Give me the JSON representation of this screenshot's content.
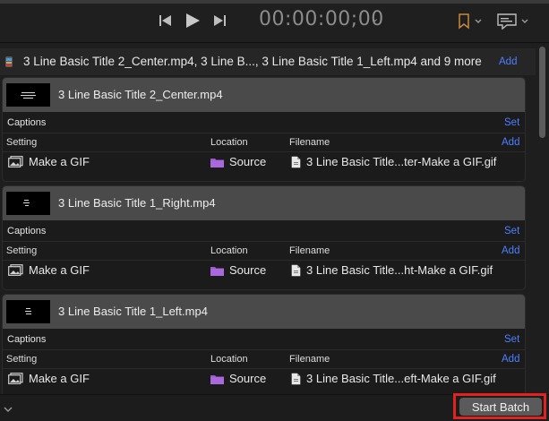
{
  "transport": {
    "timecode": "00:00:00;00",
    "timecode_caret": "⌄"
  },
  "batch": {
    "title": "3 Line Basic Title 2_Center.mp4, 3 Line B..., 3 Line Basic Title 1_Left.mp4 and 9 more",
    "add_label": "Add"
  },
  "labels": {
    "captions": "Captions",
    "set": "Set",
    "setting": "Setting",
    "location": "Location",
    "filename": "Filename",
    "add": "Add"
  },
  "jobs": [
    {
      "name": "3 Line Basic Title 2_Center.mp4",
      "setting": "Make a GIF",
      "location": "Source",
      "filename": "3 Line Basic Title...ter-Make a GIF.gif"
    },
    {
      "name": "3 Line Basic Title 1_Right.mp4",
      "setting": "Make a GIF",
      "location": "Source",
      "filename": "3 Line Basic Title...ht-Make a GIF.gif"
    },
    {
      "name": "3 Line Basic Title 1_Left.mp4",
      "setting": "Make a GIF",
      "location": "Source",
      "filename": "3 Line Basic Title...eft-Make a GIF.gif"
    }
  ],
  "footer": {
    "start_batch_label": "Start Batch"
  },
  "colors": {
    "accent_link": "#4f7fff",
    "folder_icon": "#9b59d0",
    "highlight": "#e0231e"
  }
}
